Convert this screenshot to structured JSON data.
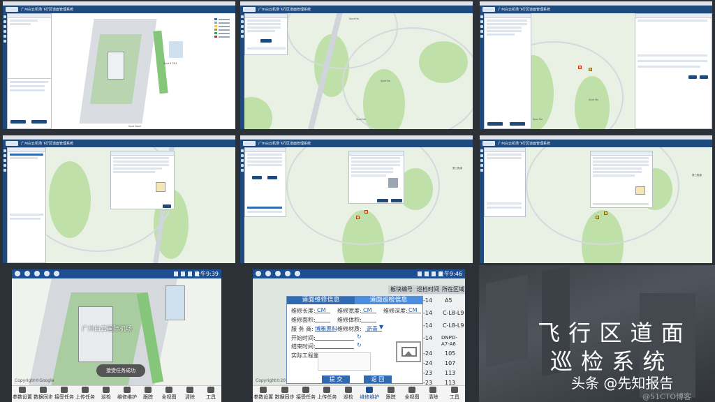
{
  "desktop": {
    "app_title": "广州白云机场飞行区道面管理系统",
    "labels": {
      "shot1": [
        "Spot 6 TN3",
        "Spot Naxh"
      ],
      "shot2": [
        "Spot No",
        "Spot No",
        "Spot No"
      ],
      "shot3": [
        "Spot No",
        "Spot No"
      ],
      "shot5": [
        "第三跑道"
      ],
      "shot6": [
        "第三跑道"
      ]
    }
  },
  "phone1": {
    "time": "上午9:39",
    "map_label": "广州白云国际机场",
    "toast": "接受任务成功",
    "copyright": "Copyright©Google"
  },
  "phone2": {
    "time": "上午9:46",
    "list_headers": [
      "板块编号",
      "巡检时间",
      "所在区域"
    ],
    "list_rows": [
      [
        "-14",
        "A5"
      ],
      [
        "-14",
        "C-L8-L9"
      ],
      [
        "-14",
        "C-L8-L9"
      ],
      [
        "-14",
        "DNPD-A7-A6"
      ],
      [
        "-24",
        "105"
      ],
      [
        "-24",
        "107"
      ],
      [
        "-23",
        "113"
      ],
      [
        "-23",
        "113"
      ]
    ],
    "dialog": {
      "tab_repair": "道面维修信息",
      "tab_inspect": "道面巡检信息",
      "repair_length_label": "维修长度:",
      "repair_width_label": "维修宽度:",
      "repair_depth_label": "维修深度:",
      "unit": "CM",
      "repair_area_label": "维修面积:",
      "repair_volume_label": "维修体积:",
      "supplier_label": "服 务 商:",
      "supplier_value": "博雅惠科",
      "material_label": "维修材质:",
      "material_value": "沥青",
      "start_time_label": "开始时间:",
      "end_time_label": "结束时间:",
      "workload_label": "实际工程量:",
      "submit": "提 交",
      "back": "返 回"
    },
    "copyright": "Copyright©2017"
  },
  "bottom_nav": [
    "参数设置",
    "数据同步",
    "接受任务",
    "上传任务",
    "巡检",
    "维修维护",
    "跟踪",
    "全视图",
    "清除",
    "工具"
  ],
  "caption": {
    "line1": "飞 行 区 道 面",
    "line2": "巡 检 系 统",
    "source": "头条 @先知报告",
    "watermark": "@51CTO博客"
  }
}
